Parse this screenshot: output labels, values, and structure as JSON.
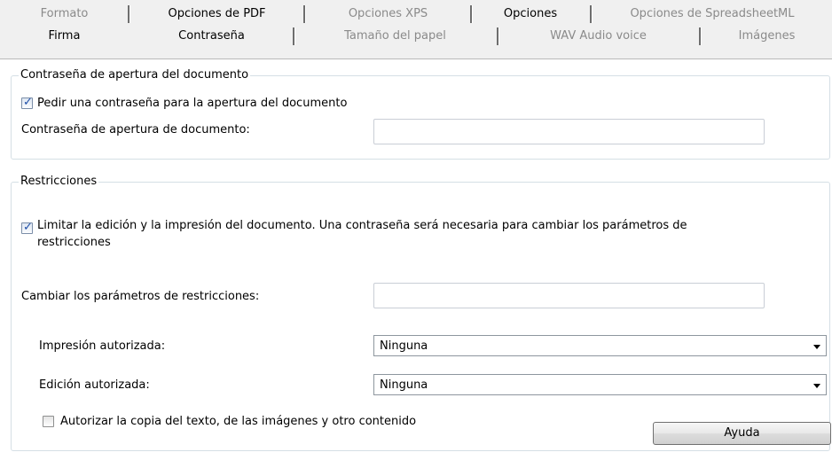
{
  "tabs": {
    "row1": [
      {
        "label": "Formato"
      },
      {
        "label": "Opciones de PDF"
      },
      {
        "label": "Opciones XPS"
      },
      {
        "label": "Opciones"
      },
      {
        "label": "Opciones de SpreadsheetML"
      }
    ],
    "row2": [
      {
        "label": "Firma"
      },
      {
        "label": "Contraseña"
      },
      {
        "label": "Tamaño del papel"
      },
      {
        "label": "WAV Audio voice"
      },
      {
        "label": "Imágenes"
      }
    ]
  },
  "open_password": {
    "legend": "Contraseña de apertura del documento",
    "require_checkbox": {
      "label": "Pedir una contraseña para la apertura del documento",
      "checked": true
    },
    "password_label": "Contraseña de apertura de documento:",
    "password_value": ""
  },
  "restrictions": {
    "legend": "Restricciones",
    "limit_checkbox": {
      "label_line1": "Limitar la edición y la impresión del documento. Una contraseña será necesaria para cambiar los parámetros de",
      "label_line2": "restricciones",
      "checked": true
    },
    "change_password_label": "Cambiar los parámetros de restricciones:",
    "change_password_value": "",
    "printing_label": "Impresión autorizada:",
    "printing_value": "Ninguna",
    "editing_label": "Edición autorizada:",
    "editing_value": "Ninguna",
    "copy_checkbox": {
      "label": "Autorizar la copia del texto, de las imágenes y otro contenido",
      "checked": false
    }
  },
  "help_button": "Ayuda",
  "colors": {
    "window_background": "#f0f0f0",
    "panel_background": "#ffffff",
    "group_border": "#d5dfe5",
    "disabled_tab_text": "#8a8a8a"
  },
  "icons": {
    "dropdown": "chevron-down-icon",
    "checkmark": "checkmark-icon"
  }
}
